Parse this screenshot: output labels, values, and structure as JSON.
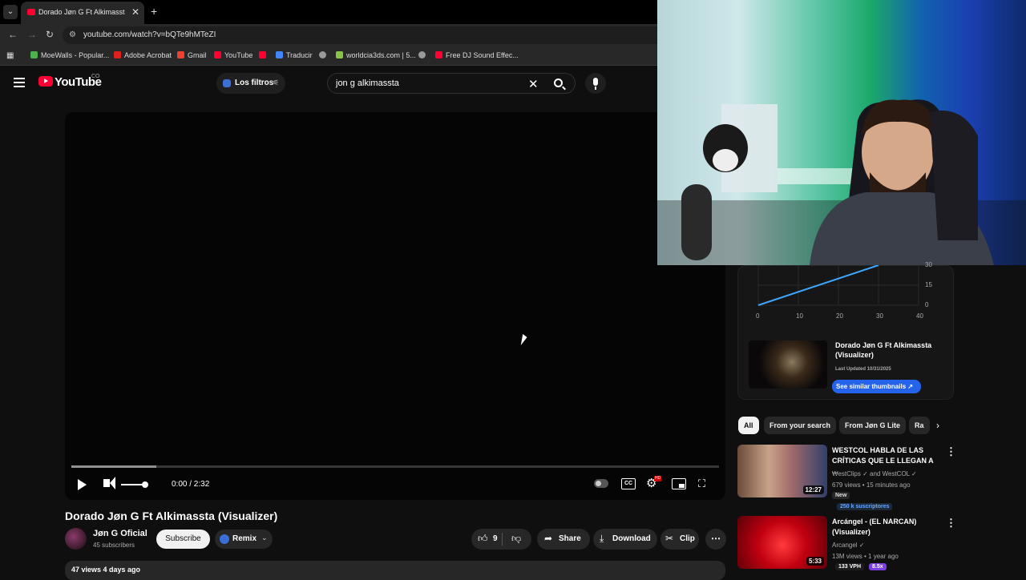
{
  "browser": {
    "tab_title": "Dorado Jøn G Ft Alkimassta (Vi",
    "url": "youtube.com/watch?v=bQTe9hMTeZI",
    "bookmarks": [
      "MoeWalls - Popular...",
      "Adobe Acrobat",
      "Gmail",
      "YouTube",
      "",
      "Traducir",
      "",
      "worldcia3ds.com | 5...",
      "",
      "Free DJ Sound Effec..."
    ]
  },
  "header": {
    "logo_text": "YouTube",
    "country": "CO",
    "filters_label": "Los filtros",
    "search_query": "jon g alkimassta"
  },
  "player": {
    "time": "0:00 / 2:32",
    "progress": 0,
    "volume": 1.0,
    "settings_badge": "HD"
  },
  "video": {
    "title": "Dorado Jøn G Ft Alkimassta (Visualizer)",
    "channel": "Jøn G Oficial",
    "subscribers": "45 subscribers",
    "subscribe_label": "Subscribe",
    "remix_label": "Remix",
    "likes": "9",
    "share_label": "Share",
    "download_label": "Download",
    "clip_label": "Clip",
    "views_line": "47 views  4 days ago"
  },
  "sidebar": {
    "chart_ticks_y": [
      "30",
      "15",
      "0"
    ],
    "chart_ticks_x": [
      "0",
      "10",
      "20",
      "30",
      "40"
    ],
    "similar_title": "Dorado Jøn G Ft Alkimassta (Visualizer)",
    "similar_date": "Last Updated 10/31/2025",
    "similar_button": "See similar thumbnails ↗",
    "chips": [
      "All",
      "From your search",
      "From Jøn G Lite",
      "Ra"
    ],
    "videos": [
      {
        "title": "WESTCOL HABLA DE LAS CRÍTICAS QUE LE LLEGAN A ...",
        "channel": "WestClips",
        "channel_extra": "and WestCOL",
        "meta": "679 views • 15 minutes ago",
        "badge": "New",
        "extra": "250 k suscriptores",
        "duration": "12:27"
      },
      {
        "title": "Arcángel - (EL NARCAN) (Visualizer)",
        "channel": "Arcangel",
        "meta": "13M views • 1 year ago",
        "vph": "133 VPH",
        "mult": "8.5x",
        "duration": "5:33"
      }
    ]
  },
  "chart_data": {
    "type": "line",
    "x": [
      0,
      30
    ],
    "y": [
      0,
      30
    ],
    "xlim": [
      0,
      40
    ],
    "ylim": [
      0,
      30
    ],
    "xticks": [
      "0",
      "10",
      "20",
      "30",
      "40"
    ],
    "yticks": [
      "30",
      "15",
      "0"
    ],
    "grid": true,
    "color": "#3ea6ff"
  }
}
